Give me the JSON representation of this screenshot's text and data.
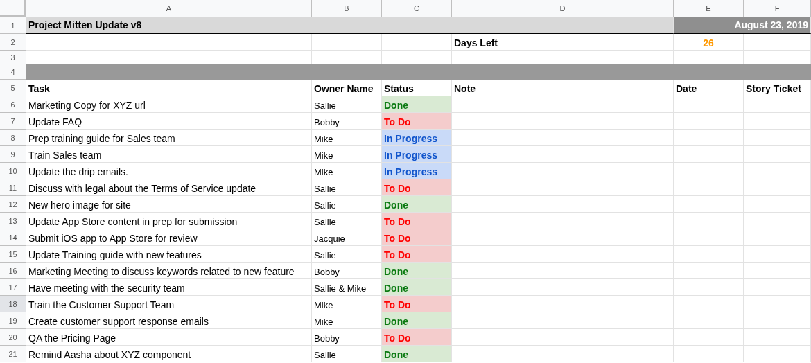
{
  "columns": [
    "A",
    "B",
    "C",
    "D",
    "E",
    "F"
  ],
  "title_row": {
    "row_number": "1",
    "title": "Project Mitten Update v8",
    "date": "August 23, 2019"
  },
  "days_row": {
    "row_number": "2",
    "label": "Days Left",
    "value": "26"
  },
  "blank_row": {
    "row_number": "3"
  },
  "separator_row": {
    "row_number": "4"
  },
  "header_row": {
    "row_number": "5",
    "cells": [
      "Task",
      "Owner Name",
      "Status",
      "Note",
      "Date",
      "Story Ticket"
    ]
  },
  "tasks": [
    {
      "row_number": "6",
      "task": "Marketing Copy for XYZ url",
      "owner": "Sallie",
      "status": {
        "label": "Done",
        "kind": "done"
      },
      "selected": false
    },
    {
      "row_number": "7",
      "task": "Update FAQ",
      "owner": "Bobby",
      "status": {
        "label": "To Do",
        "kind": "todo"
      },
      "selected": false
    },
    {
      "row_number": "8",
      "task": "Prep training guide for Sales team",
      "owner": "Mike",
      "status": {
        "label": "In Progress",
        "kind": "in_progress"
      },
      "selected": false
    },
    {
      "row_number": "9",
      "task": "Train Sales team",
      "owner": "Mike",
      "status": {
        "label": "In Progress",
        "kind": "in_progress"
      },
      "selected": false
    },
    {
      "row_number": "10",
      "task": "Update the drip emails.",
      "owner": "Mike",
      "status": {
        "label": "In Progress",
        "kind": "in_progress"
      },
      "selected": false
    },
    {
      "row_number": "11",
      "task": "Discuss with legal about the Terms of Service update",
      "owner": "Sallie",
      "status": {
        "label": "To Do",
        "kind": "todo"
      },
      "selected": false
    },
    {
      "row_number": "12",
      "task": "New hero image for site",
      "owner": "Sallie",
      "status": {
        "label": "Done",
        "kind": "done"
      },
      "selected": false
    },
    {
      "row_number": "13",
      "task": "Update App Store content in prep for submission",
      "owner": "Sallie",
      "status": {
        "label": "To Do",
        "kind": "todo"
      },
      "selected": false
    },
    {
      "row_number": "14",
      "task": "Submit iOS app to App Store for review",
      "owner": "Jacquie",
      "status": {
        "label": "To Do",
        "kind": "todo"
      },
      "selected": false
    },
    {
      "row_number": "15",
      "task": "Update Training guide with new features",
      "owner": "Sallie",
      "status": {
        "label": "To Do",
        "kind": "todo"
      },
      "selected": false
    },
    {
      "row_number": "16",
      "task": "Marketing Meeting to discuss keywords related to new feature",
      "owner": "Bobby",
      "status": {
        "label": "Done",
        "kind": "done"
      },
      "selected": false
    },
    {
      "row_number": "17",
      "task": "Have meeting with the security team",
      "owner": "Sallie & Mike",
      "status": {
        "label": "Done",
        "kind": "done"
      },
      "selected": false
    },
    {
      "row_number": "18",
      "task": "Train the Customer Support Team",
      "owner": "Mike",
      "status": {
        "label": "To Do",
        "kind": "todo"
      },
      "selected": true
    },
    {
      "row_number": "19",
      "task": "Create customer support response emails",
      "owner": "Mike",
      "status": {
        "label": "Done",
        "kind": "done"
      },
      "selected": false
    },
    {
      "row_number": "20",
      "task": "QA the Pricing Page",
      "owner": "Bobby",
      "status": {
        "label": "To Do",
        "kind": "todo"
      },
      "selected": false
    },
    {
      "row_number": "21",
      "task": "Remind Aasha about XYZ component",
      "owner": "Sallie",
      "status": {
        "label": "Done",
        "kind": "done"
      },
      "selected": false
    }
  ]
}
